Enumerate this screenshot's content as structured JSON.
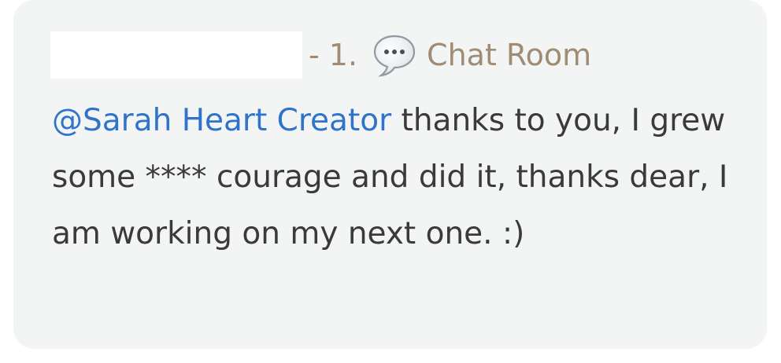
{
  "comment": {
    "number_prefix": "- 1.",
    "room_label": "Chat Room",
    "room_icon": "speech-bubble-icon",
    "mention": "@Sarah Heart Creator",
    "text": " thanks to you, I grew some **** courage and did it, thanks dear, I am working on my next one. :)"
  },
  "colors": {
    "card_bg": "#f3f5f5",
    "mention": "#2f74c8",
    "meta": "#a08b73",
    "body_text": "#3a3a3a"
  }
}
